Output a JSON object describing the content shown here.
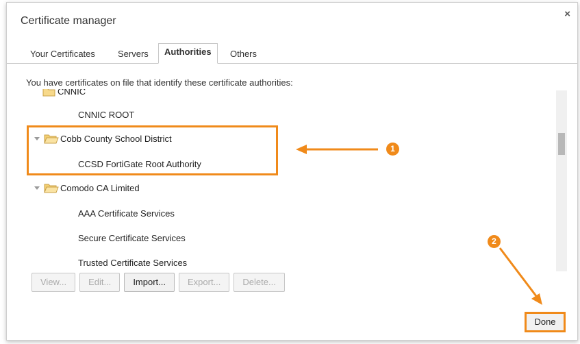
{
  "dialog": {
    "title": "Certificate manager",
    "close_label": "×"
  },
  "tabs": [
    {
      "label": "Your Certificates",
      "active": false
    },
    {
      "label": "Servers",
      "active": false
    },
    {
      "label": "Authorities",
      "active": true
    },
    {
      "label": "Others",
      "active": false
    }
  ],
  "description": "You have certificates on file that identify these certificate authorities:",
  "tree": {
    "partial_group": "CNNIC",
    "items": [
      {
        "type": "cert",
        "label": "CNNIC ROOT"
      },
      {
        "type": "group",
        "label": "Cobb County School District"
      },
      {
        "type": "cert",
        "label": "CCSD FortiGate Root Authority"
      },
      {
        "type": "group",
        "label": "Comodo CA Limited"
      },
      {
        "type": "cert",
        "label": "AAA Certificate Services"
      },
      {
        "type": "cert",
        "label": "Secure Certificate Services"
      },
      {
        "type": "cert",
        "label": "Trusted Certificate Services"
      }
    ]
  },
  "buttons": {
    "view": "View...",
    "edit": "Edit...",
    "import": "Import...",
    "export": "Export...",
    "delete": "Delete...",
    "done": "Done"
  },
  "annotations": {
    "callout_1": "1",
    "callout_2": "2",
    "accent_color": "#f08a1a"
  }
}
